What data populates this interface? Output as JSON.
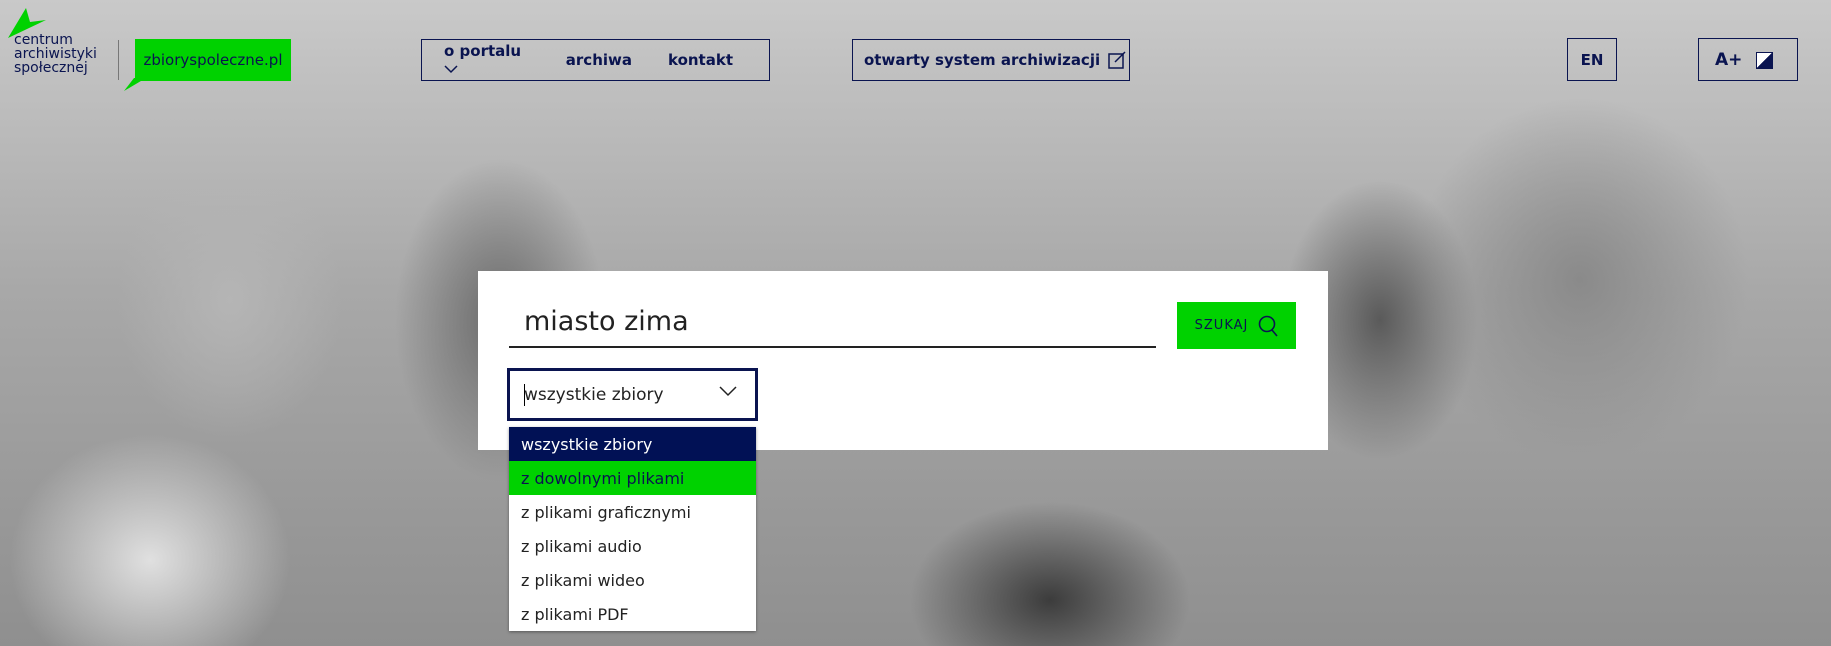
{
  "logo": {
    "text": "centrum archiwistyki społecznej",
    "lines": [
      "centrum",
      "archiwistyki",
      "społecznej"
    ]
  },
  "site_button": "zbioryspoleczne.pl",
  "nav": {
    "items": [
      "o portalu",
      "archiwa",
      "kontakt"
    ]
  },
  "external_link": "otwarty system archiwizacji",
  "language": "EN",
  "font_size": "A+",
  "search": {
    "query": "miasto zima",
    "button": "SZUKAJ"
  },
  "filter": {
    "selected": "wszystkie zbiory",
    "options": [
      "wszystkie zbiory",
      "z dowolnymi plikami",
      "z plikami graficznymi",
      "z plikami audio",
      "z plikami wideo",
      "z plikami PDF"
    ],
    "highlighted": "z dowolnymi plikami"
  },
  "colors": {
    "brand_green": "#00d200",
    "navy": "#0a1450"
  }
}
